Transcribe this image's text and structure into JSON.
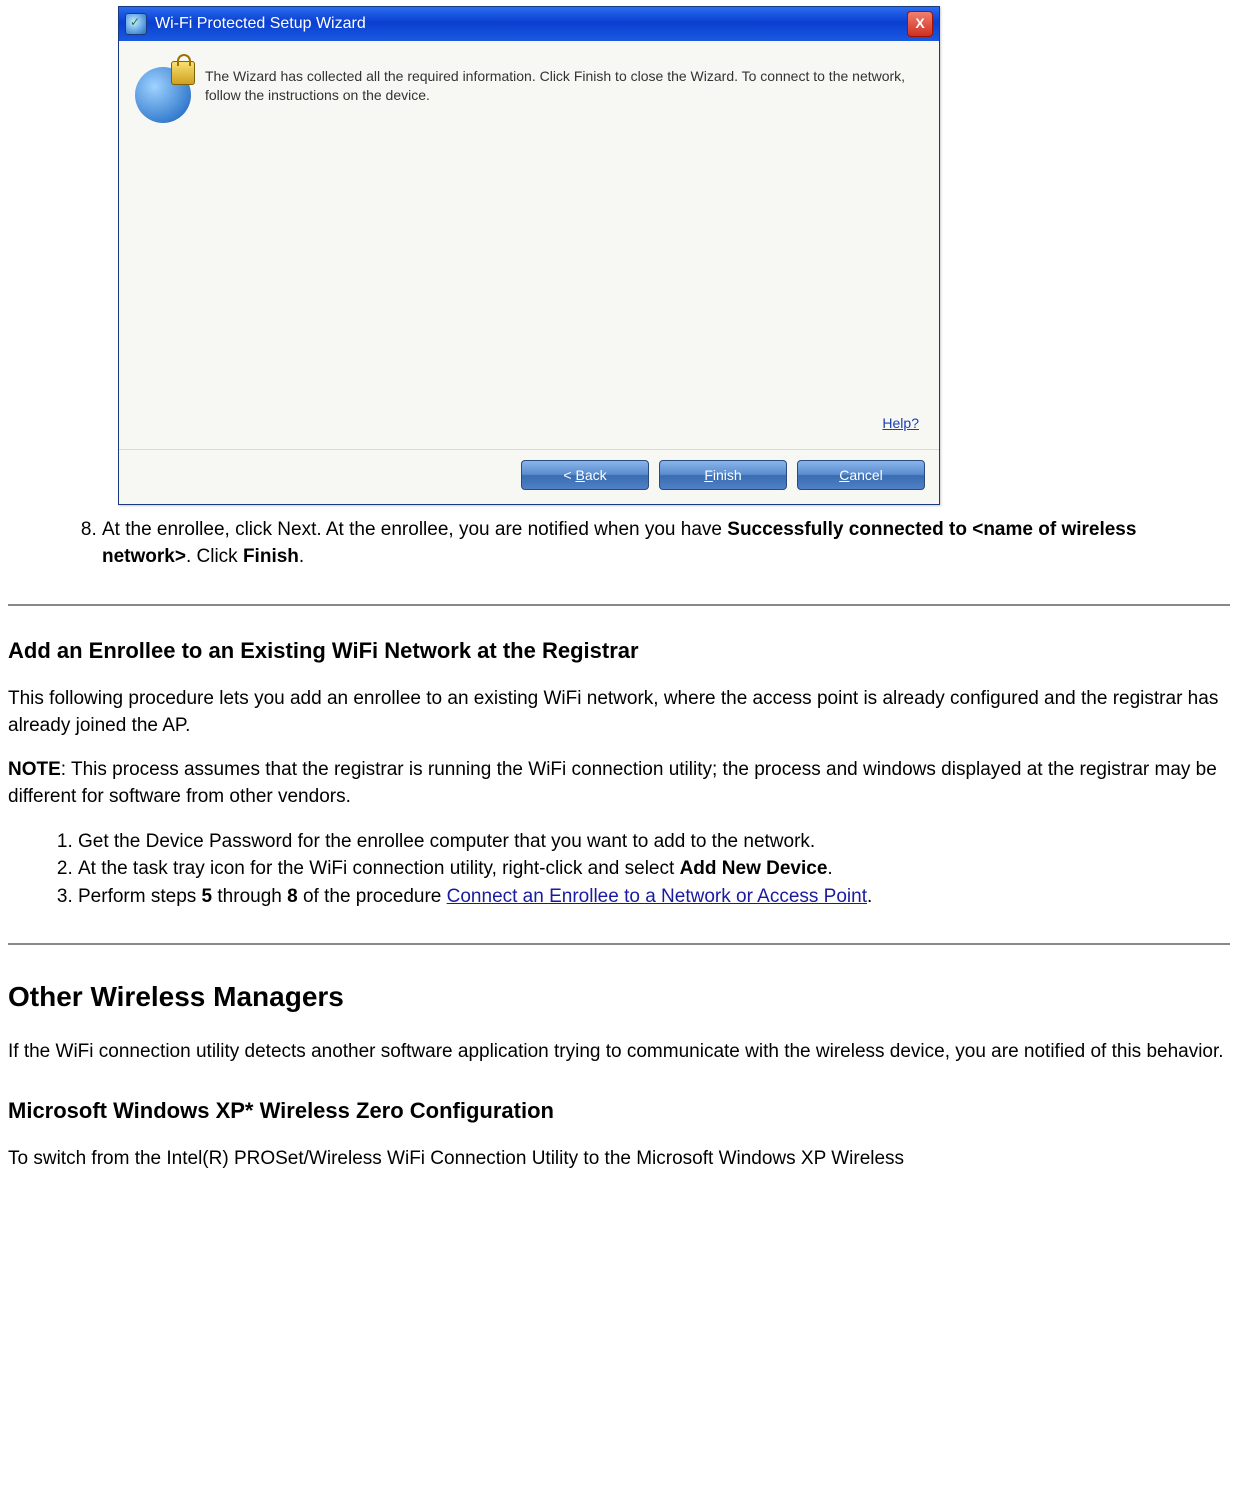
{
  "wizard": {
    "title": "Wi-Fi Protected Setup Wizard",
    "message": "The Wizard has collected all the required information. Click Finish to close the Wizard. To connect to the network, follow the instructions on the device.",
    "help_label": "Help?",
    "buttons": {
      "back_prefix": "< ",
      "back_u": "B",
      "back_rest": "ack",
      "finish_u": "F",
      "finish_rest": "inish",
      "cancel_u": "C",
      "cancel_rest": "ancel"
    }
  },
  "step8": {
    "number": "8.",
    "text_a": "At the enrollee, click Next. At the enrollee, you are notified when you have ",
    "bold_a": "Successfully connected to <name of wireless network>",
    "text_b": ". Click ",
    "bold_b": "Finish",
    "text_c": "."
  },
  "section_enrollee": {
    "heading": "Add an Enrollee to an Existing WiFi Network at the Registrar",
    "para1": "This following procedure lets you add an enrollee to an existing WiFi network, where the access point is already configured and the registrar has already joined the AP.",
    "note_label": "NOTE",
    "note_text": ": This process assumes that the registrar is running the WiFi connection utility; the process and windows displayed at the registrar may be different for software from other vendors.",
    "steps": {
      "s1": "Get the Device Password for the enrollee computer that you want to add to the network.",
      "s2_a": "At the task tray icon for the WiFi connection utility, right-click and select ",
      "s2_bold": "Add New Device",
      "s2_b": ".",
      "s3_a": "Perform steps ",
      "s3_bold5": "5",
      "s3_mid": " through ",
      "s3_bold8": "8",
      "s3_b": " of the procedure ",
      "s3_link": "Connect an Enrollee to a Network or Access Point",
      "s3_c": "."
    }
  },
  "section_other": {
    "heading": "Other Wireless Managers",
    "para": "If the WiFi connection utility detects another software application trying to communicate with the wireless device, you are notified of this behavior.",
    "sub_heading": "Microsoft Windows XP* Wireless Zero Configuration",
    "para2": "To switch from the Intel(R) PROSet/Wireless WiFi Connection Utility to the Microsoft Windows XP Wireless"
  }
}
